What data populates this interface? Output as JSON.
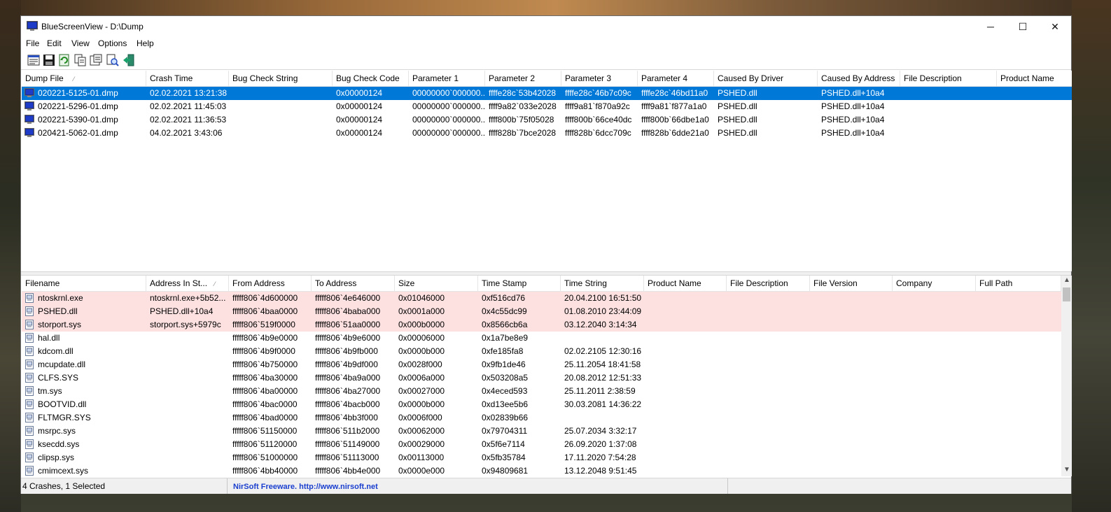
{
  "window": {
    "title": "BlueScreenView  -  D:\\Dump"
  },
  "window_controls": {
    "minimize": "─",
    "maximize": "☐",
    "close": "✕"
  },
  "menu": [
    "File",
    "Edit",
    "View",
    "Options",
    "Help"
  ],
  "toolbar": [
    "html-report-icon",
    "save-icon",
    "refresh-icon",
    "copy-icon",
    "properties-icon",
    "find-icon",
    "exit-icon"
  ],
  "upper": {
    "sort_indicator": "⁄",
    "columns": [
      "Dump File",
      "Crash Time",
      "Bug Check String",
      "Bug Check Code",
      "Parameter 1",
      "Parameter 2",
      "Parameter 3",
      "Parameter 4",
      "Caused By Driver",
      "Caused By Address",
      "File Description",
      "Product Name"
    ],
    "rows": [
      [
        "020221-5125-01.dmp",
        "02.02.2021 13:21:38",
        "",
        "0x00000124",
        "00000000`000000...",
        "ffffe28c`53b42028",
        "ffffe28c`46b7c09c",
        "ffffe28c`46bd11a0",
        "PSHED.dll",
        "PSHED.dll+10a4",
        "",
        ""
      ],
      [
        "020221-5296-01.dmp",
        "02.02.2021 11:45:03",
        "",
        "0x00000124",
        "00000000`000000...",
        "ffff9a82`033e2028",
        "ffff9a81`f870a92c",
        "ffff9a81`f877a1a0",
        "PSHED.dll",
        "PSHED.dll+10a4",
        "",
        ""
      ],
      [
        "020221-5390-01.dmp",
        "02.02.2021 11:36:53",
        "",
        "0x00000124",
        "00000000`000000...",
        "ffff800b`75f05028",
        "ffff800b`66ce40dc",
        "ffff800b`66dbe1a0",
        "PSHED.dll",
        "PSHED.dll+10a4",
        "",
        ""
      ],
      [
        "020421-5062-01.dmp",
        "04.02.2021 3:43:06",
        "",
        "0x00000124",
        "00000000`000000...",
        "ffff828b`7bce2028",
        "ffff828b`6dcc709c",
        "ffff828b`6dde21a0",
        "PSHED.dll",
        "PSHED.dll+10a4",
        "",
        ""
      ]
    ],
    "selected_index": 0
  },
  "lower": {
    "sort_indicator": "⁄",
    "columns": [
      "Filename",
      "Address In St...",
      "From Address",
      "To Address",
      "Size",
      "Time Stamp",
      "Time String",
      "Product Name",
      "File Description",
      "File Version",
      "Company",
      "Full Path"
    ],
    "rows": [
      [
        "ntoskrnl.exe",
        "ntoskrnl.exe+5b52...",
        "fffff806`4d600000",
        "fffff806`4e646000",
        "0x01046000",
        "0xf516cd76",
        "20.04.2100 16:51:50",
        "",
        "",
        "",
        "",
        ""
      ],
      [
        "PSHED.dll",
        "PSHED.dll+10a4",
        "fffff806`4baa0000",
        "fffff806`4baba000",
        "0x0001a000",
        "0x4c55dc99",
        "01.08.2010 23:44:09",
        "",
        "",
        "",
        "",
        ""
      ],
      [
        "storport.sys",
        "storport.sys+5979c",
        "fffff806`519f0000",
        "fffff806`51aa0000",
        "0x000b0000",
        "0x8566cb6a",
        "03.12.2040 3:14:34",
        "",
        "",
        "",
        "",
        ""
      ],
      [
        "hal.dll",
        "",
        "fffff806`4b9e0000",
        "fffff806`4b9e6000",
        "0x00006000",
        "0x1a7be8e9",
        "",
        "",
        "",
        "",
        "",
        ""
      ],
      [
        "kdcom.dll",
        "",
        "fffff806`4b9f0000",
        "fffff806`4b9fb000",
        "0x0000b000",
        "0xfe185fa8",
        "02.02.2105 12:30:16",
        "",
        "",
        "",
        "",
        ""
      ],
      [
        "mcupdate.dll",
        "",
        "fffff806`4b750000",
        "fffff806`4b9df000",
        "0x0028f000",
        "0x9fb1de46",
        "25.11.2054 18:41:58",
        "",
        "",
        "",
        "",
        ""
      ],
      [
        "CLFS.SYS",
        "",
        "fffff806`4ba30000",
        "fffff806`4ba9a000",
        "0x0006a000",
        "0x503208a5",
        "20.08.2012 12:51:33",
        "",
        "",
        "",
        "",
        ""
      ],
      [
        "tm.sys",
        "",
        "fffff806`4ba00000",
        "fffff806`4ba27000",
        "0x00027000",
        "0x4eced593",
        "25.11.2011 2:38:59",
        "",
        "",
        "",
        "",
        ""
      ],
      [
        "BOOTVID.dll",
        "",
        "fffff806`4bac0000",
        "fffff806`4bacb000",
        "0x0000b000",
        "0xd13ee5b6",
        "30.03.2081 14:36:22",
        "",
        "",
        "",
        "",
        ""
      ],
      [
        "FLTMGR.SYS",
        "",
        "fffff806`4bad0000",
        "fffff806`4bb3f000",
        "0x0006f000",
        "0x02839b66",
        "",
        "",
        "",
        "",
        "",
        ""
      ],
      [
        "msrpc.sys",
        "",
        "fffff806`51150000",
        "fffff806`511b2000",
        "0x00062000",
        "0x79704311",
        "25.07.2034 3:32:17",
        "",
        "",
        "",
        "",
        ""
      ],
      [
        "ksecdd.sys",
        "",
        "fffff806`51120000",
        "fffff806`51149000",
        "0x00029000",
        "0x5f6e7114",
        "26.09.2020 1:37:08",
        "",
        "",
        "",
        "",
        ""
      ],
      [
        "clipsp.sys",
        "",
        "fffff806`51000000",
        "fffff806`51113000",
        "0x00113000",
        "0x5fb35784",
        "17.11.2020 7:54:28",
        "",
        "",
        "",
        "",
        ""
      ],
      [
        "cmimcext.sys",
        "",
        "fffff806`4bb40000",
        "fffff806`4bb4e000",
        "0x0000e000",
        "0x94809681",
        "13.12.2048 9:51:45",
        "",
        "",
        "",
        "",
        ""
      ]
    ],
    "highlighted_count": 3
  },
  "status": {
    "count": "4 Crashes, 1 Selected",
    "link": "NirSoft Freeware.  http://www.nirsoft.net"
  },
  "colors": {
    "selection": "#0078d7",
    "highlight_row": "#fde0e0",
    "link": "#1a3fcf"
  }
}
